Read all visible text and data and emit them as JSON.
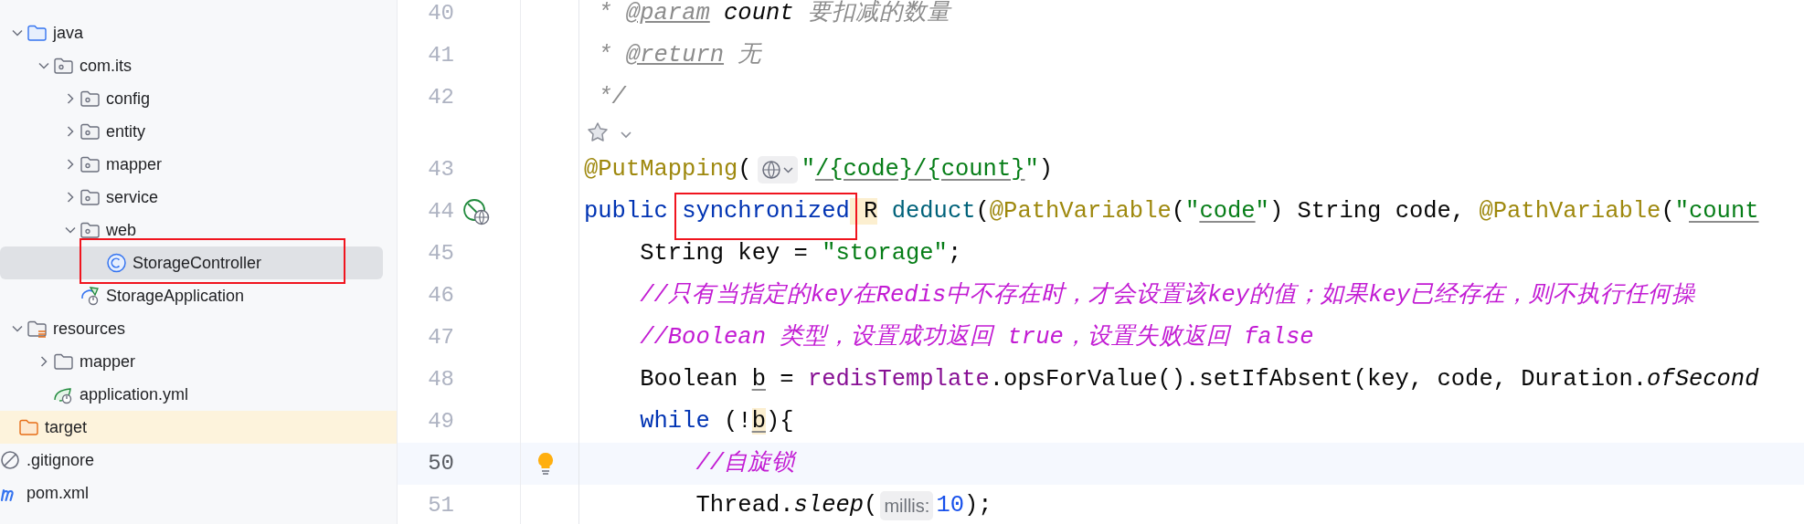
{
  "project_tree": {
    "items": [
      {
        "children": [
          {
            "label": "java",
            "kind": "source-folder",
            "expanded": true,
            "children": [
              {
                "label": "com.its",
                "kind": "package",
                "expanded": true,
                "children": [
                  {
                    "label": "config",
                    "kind": "package",
                    "expanded": false
                  },
                  {
                    "label": "entity",
                    "kind": "package",
                    "expanded": false
                  },
                  {
                    "label": "mapper",
                    "kind": "package",
                    "expanded": false
                  },
                  {
                    "label": "service",
                    "kind": "package",
                    "expanded": false
                  },
                  {
                    "label": "web",
                    "kind": "package",
                    "expanded": true,
                    "children": [
                      {
                        "label": "StorageController",
                        "kind": "class",
                        "selected": true,
                        "boxed": true
                      }
                    ]
                  },
                  {
                    "label": "StorageApplication",
                    "kind": "spring-app",
                    "selected": false
                  }
                ]
              }
            ]
          },
          {
            "label": "resources",
            "kind": "resources-folder",
            "expanded": true,
            "children": [
              {
                "label": "mapper",
                "kind": "folder",
                "expanded": false
              },
              {
                "label": "application.yml",
                "kind": "yml",
                "selected": false
              }
            ]
          }
        ]
      },
      {
        "label": "target",
        "kind": "excluded-folder",
        "selected": false
      },
      {
        "label": ".gitignore",
        "kind": "ignore",
        "selected": false
      },
      {
        "label": "pom.xml",
        "kind": "maven",
        "selected": false
      }
    ]
  },
  "editor": {
    "lines": [
      {
        "kind": "code",
        "number": "40",
        "tokens": [
          {
            "kind": "doc",
            "text": " * "
          },
          {
            "kind": "doc-tag",
            "text": "@param"
          },
          {
            "kind": "doc-param",
            "text": " count"
          },
          {
            "kind": "doc",
            "text": " 要扣减的数量"
          }
        ]
      },
      {
        "kind": "code",
        "number": "41",
        "tokens": [
          {
            "kind": "doc",
            "text": " * "
          },
          {
            "kind": "doc-tag",
            "text": "@return"
          },
          {
            "kind": "doc",
            "text": " 无"
          }
        ]
      },
      {
        "kind": "code",
        "number": "42",
        "tokens": [
          {
            "kind": "doc",
            "text": " */"
          }
        ]
      },
      {
        "kind": "inlay"
      },
      {
        "kind": "code",
        "number": "43",
        "tokens": [
          {
            "kind": "annotation",
            "text": "@PutMapping"
          },
          {
            "kind": "plain",
            "text": "("
          },
          {
            "kind": "globe-inlay"
          },
          {
            "kind": "string",
            "text": "\""
          },
          {
            "kind": "string",
            "text": "/{code}/{count}",
            "underlined": true
          },
          {
            "kind": "string",
            "text": "\""
          },
          {
            "kind": "plain",
            "text": ")"
          }
        ]
      },
      {
        "kind": "code",
        "number": "44",
        "gutter": {
          "kind": "endpoint"
        },
        "tokens": [
          {
            "kind": "keyword",
            "text": "public "
          },
          {
            "kind": "keyword",
            "text": "synchronized",
            "boxed": true
          },
          {
            "kind": "plain",
            "text": " R",
            "highlighted": true
          },
          {
            "kind": "method",
            "text": " deduct"
          },
          {
            "kind": "plain",
            "text": "("
          },
          {
            "kind": "annotation",
            "text": "@PathVariable"
          },
          {
            "kind": "plain",
            "text": "("
          },
          {
            "kind": "string",
            "text": "\""
          },
          {
            "kind": "string",
            "text": "code",
            "underlined": true
          },
          {
            "kind": "string",
            "text": "\""
          },
          {
            "kind": "plain",
            "text": ") String code, "
          },
          {
            "kind": "annotation",
            "text": "@PathVariable"
          },
          {
            "kind": "plain",
            "text": "("
          },
          {
            "kind": "string",
            "text": "\""
          },
          {
            "kind": "string",
            "text": "count",
            "underlined": true
          }
        ]
      },
      {
        "kind": "code",
        "number": "45",
        "tokens": [
          {
            "kind": "plain",
            "text": "    String key = "
          },
          {
            "kind": "string",
            "text": "\"storage\""
          },
          {
            "kind": "plain",
            "text": ";"
          }
        ]
      },
      {
        "kind": "code",
        "number": "46",
        "tokens": [
          {
            "kind": "comment",
            "text": "    //只有当指定的key在Redis中不存在时，才会设置该key的值；如果key已经存在，则不执行任何操"
          }
        ]
      },
      {
        "kind": "code",
        "number": "47",
        "tokens": [
          {
            "kind": "comment",
            "text": "    //Boolean 类型，设置成功返回 true，设置失败返回 false"
          }
        ]
      },
      {
        "kind": "code",
        "number": "48",
        "tokens": [
          {
            "kind": "plain",
            "text": "    Boolean "
          },
          {
            "kind": "plain",
            "text": "b",
            "underlined": true
          },
          {
            "kind": "plain",
            "text": " = "
          },
          {
            "kind": "field",
            "text": "redisTemplate"
          },
          {
            "kind": "plain",
            "text": ".opsForValue().setIfAbsent(key, code, Duration."
          },
          {
            "kind": "static",
            "text": "ofSecond"
          }
        ]
      },
      {
        "kind": "code",
        "number": "49",
        "tokens": [
          {
            "kind": "keyword",
            "text": "    while"
          },
          {
            "kind": "plain",
            "text": " (!"
          },
          {
            "kind": "plain",
            "text": "b",
            "underlined": true,
            "highlighted": true
          },
          {
            "kind": "plain",
            "text": "){"
          }
        ]
      },
      {
        "kind": "code",
        "number": "50",
        "current": true,
        "gutter": {
          "kind": "bulb"
        },
        "tokens": [
          {
            "kind": "comment",
            "text": "        //自旋锁"
          }
        ]
      },
      {
        "kind": "code",
        "number": "51",
        "tokens": [
          {
            "kind": "plain",
            "text": "        Thread."
          },
          {
            "kind": "static",
            "text": "sleep"
          },
          {
            "kind": "plain",
            "text": "("
          },
          {
            "kind": "hint",
            "text": "millis:"
          },
          {
            "kind": "number",
            "text": "10"
          },
          {
            "kind": "plain",
            "text": ");"
          }
        ]
      }
    ]
  }
}
